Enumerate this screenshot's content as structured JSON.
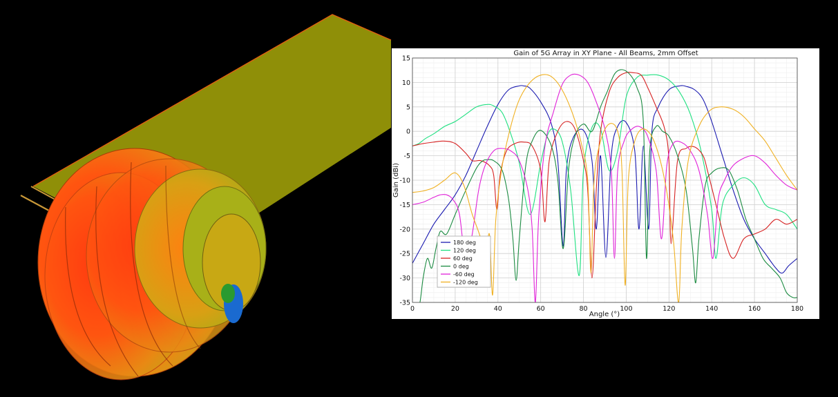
{
  "scene": {
    "board_color": "#8f8f08",
    "board_edge_color": "#e06010",
    "pattern_colors": [
      "#ff3a10",
      "#ff6a12",
      "#d89a14",
      "#a8b018",
      "#2a9a30",
      "#1a6ad0"
    ]
  },
  "chart_data": {
    "type": "line",
    "title": "Gain of 5G Array in XY Plane - All Beams, 2mm Offset",
    "xlabel": "Angle (°)",
    "ylabel": "Gain (dBi)",
    "xlim": [
      0,
      180
    ],
    "ylim": [
      -35,
      15
    ],
    "xticks": [
      0,
      20,
      40,
      60,
      80,
      100,
      120,
      140,
      160,
      180
    ],
    "yticks": [
      15,
      10,
      5,
      0,
      -5,
      -10,
      -15,
      -20,
      -25,
      -30,
      -35
    ],
    "grid": true,
    "legend_position": "bottom-left",
    "series": [
      {
        "name": "180 deg",
        "color": "#1a1ab0",
        "x": [
          0,
          5,
          10,
          15,
          20,
          25,
          30,
          35,
          40,
          45,
          50,
          52,
          55,
          60,
          65,
          68,
          70.5,
          72,
          75,
          80,
          84,
          86,
          88,
          90.5,
          93,
          96,
          100,
          104,
          106,
          108,
          110.5,
          112,
          115,
          120,
          125,
          128,
          132,
          136,
          140,
          145,
          150,
          155,
          160,
          165,
          170,
          173,
          176,
          180
        ],
        "y": [
          -27,
          -23,
          -19,
          -16,
          -13,
          -9,
          -4,
          1,
          5.5,
          8.5,
          9.3,
          9.3,
          8.8,
          6,
          1.5,
          -6,
          -23.5,
          -8,
          -1.5,
          0.2,
          -6,
          -20,
          -5,
          -25.8,
          -5,
          1,
          1.8,
          -4,
          -20,
          -3,
          -20,
          0,
          5,
          8.5,
          9.3,
          9.2,
          8.5,
          6.5,
          2,
          -5,
          -12,
          -18,
          -22,
          -25,
          -28,
          -29,
          -27.5,
          -26
        ]
      },
      {
        "name": "120 deg",
        "color": "#1ee080",
        "x": [
          0,
          3,
          6,
          10,
          15,
          20,
          25,
          30,
          35,
          38,
          42,
          46,
          50,
          55,
          60,
          63,
          66,
          70,
          74,
          78,
          80,
          84,
          88,
          92,
          96,
          100,
          105,
          110,
          115,
          120,
          125,
          130,
          135,
          140,
          142,
          145,
          150,
          155,
          160,
          165,
          170,
          175,
          180
        ],
        "y": [
          -3,
          -2.5,
          -1.5,
          -0.5,
          1,
          2,
          3.5,
          5,
          5.5,
          5.2,
          3.8,
          -0.5,
          -6.5,
          -17,
          -6.5,
          -1,
          0.5,
          -2,
          -12,
          -29.5,
          -8,
          0.8,
          0.5,
          -8,
          -4,
          7,
          11,
          11.5,
          11.5,
          10.5,
          8,
          3.5,
          -4,
          -16,
          -26,
          -15,
          -11,
          -9.5,
          -11,
          -15,
          -16,
          -17,
          -20
        ]
      },
      {
        "name": "60 deg",
        "color": "#d62020",
        "x": [
          0,
          5,
          10,
          15,
          20,
          25,
          28,
          32,
          36,
          38,
          39.5,
          41,
          44,
          48,
          52,
          56,
          60,
          62,
          64,
          68,
          72,
          76,
          80,
          82,
          84,
          86,
          88,
          92,
          96,
          100,
          103,
          107,
          110,
          114,
          118,
          120,
          121,
          124,
          128,
          132,
          136,
          138,
          142,
          146,
          150,
          155,
          160,
          165,
          170,
          175,
          180
        ],
        "y": [
          -3,
          -2.5,
          -2.2,
          -2,
          -2.5,
          -4.5,
          -6,
          -6,
          -7,
          -9,
          -16,
          -9,
          -4,
          -2.5,
          -2.2,
          -3,
          -8,
          -18.5,
          -6,
          0,
          2,
          0.5,
          -6,
          -12,
          -30,
          -12,
          0,
          8,
          11,
          12,
          12,
          11.5,
          9,
          5,
          0.5,
          -6,
          -23,
          -6,
          -3.5,
          -3.2,
          -5,
          -8,
          -15,
          -22,
          -26,
          -22,
          -21,
          -20,
          -18,
          -19,
          -18
        ]
      },
      {
        "name": "0 deg",
        "color": "#1a8a40",
        "x": [
          0,
          3,
          5,
          7,
          9,
          11,
          13,
          16,
          20,
          25,
          30,
          33,
          35,
          38,
          42,
          45,
          47,
          48.5,
          50,
          53,
          56,
          60,
          65,
          68,
          70.5,
          73,
          76,
          80,
          84,
          88,
          91,
          95,
          100,
          105,
          108,
          109.5,
          111,
          114,
          117,
          120,
          124,
          128,
          131,
          132.5,
          134,
          137,
          140,
          144,
          148,
          152,
          156,
          160,
          164,
          168,
          172,
          175,
          178,
          180
        ],
        "y": [
          -35,
          -36,
          -30,
          -26,
          -28,
          -24,
          -20.5,
          -21,
          -17,
          -12,
          -7.5,
          -6,
          -5.8,
          -6,
          -8,
          -14,
          -22,
          -30.5,
          -22,
          -7,
          -2,
          0.2,
          -3,
          -10,
          -24,
          -8,
          -1,
          1.5,
          0,
          5,
          8,
          12,
          12.3,
          9,
          2,
          -26,
          -4,
          1,
          0,
          -1,
          -5,
          -12,
          -24,
          -31,
          -22,
          -11,
          -8.5,
          -7.5,
          -8,
          -12,
          -18,
          -22,
          -26,
          -28,
          -30,
          -33,
          -34,
          -34
        ]
      },
      {
        "name": "-60 deg",
        "color": "#e020d8",
        "x": [
          0,
          5,
          10,
          13,
          16,
          19,
          22,
          25,
          28,
          31,
          34,
          38,
          42,
          46,
          50,
          54,
          56,
          57.5,
          59,
          62,
          66,
          70,
          74,
          78,
          82,
          86,
          90,
          93,
          94.5,
          96,
          99,
          102,
          106,
          110,
          114,
          116.5,
          119,
          122,
          126,
          130,
          134,
          138,
          140.5,
          143,
          146,
          150,
          155,
          160,
          165,
          170,
          175,
          180
        ],
        "y": [
          -15,
          -14.5,
          -13.5,
          -13,
          -13,
          -14,
          -17,
          -27,
          -21,
          -12,
          -7,
          -4,
          -3.5,
          -4,
          -6,
          -12,
          -20,
          -35,
          -18,
          -3,
          4,
          9.5,
          11.5,
          11.5,
          10,
          6,
          0.5,
          -8,
          -26,
          -8,
          -2,
          0.2,
          1,
          -1,
          -8,
          -22,
          -7,
          -2.5,
          -2.3,
          -4,
          -8,
          -17,
          -26,
          -14,
          -10,
          -7,
          -5.5,
          -5,
          -6.5,
          -9,
          -11,
          -12
        ]
      },
      {
        "name": "-120 deg",
        "color": "#f0b020",
        "x": [
          0,
          5,
          10,
          15,
          20,
          24,
          28,
          32,
          34,
          36,
          37.5,
          39,
          42,
          46,
          50,
          55,
          60,
          65,
          70,
          75,
          79,
          82,
          83.5,
          85,
          88,
          92,
          96,
          98,
          99.5,
          101,
          104,
          108,
          113,
          118,
          122,
          124.5,
          126,
          129,
          134,
          139,
          144,
          150,
          155,
          160,
          165,
          170,
          175,
          180
        ],
        "y": [
          -12.5,
          -12.2,
          -11.5,
          -10,
          -8.5,
          -11,
          -17,
          -22,
          -27,
          -21,
          -33.5,
          -18,
          -7,
          1,
          6.5,
          10,
          11.5,
          11.2,
          8.5,
          3.5,
          -2.5,
          -10,
          -29,
          -10,
          -2,
          1.5,
          0,
          -8,
          -31.5,
          -10,
          -2,
          0.5,
          -2,
          -10,
          -22,
          -35,
          -20,
          -6,
          1,
          4.2,
          5,
          4.5,
          3,
          0.5,
          -2,
          -5.5,
          -9,
          -12
        ]
      }
    ]
  }
}
